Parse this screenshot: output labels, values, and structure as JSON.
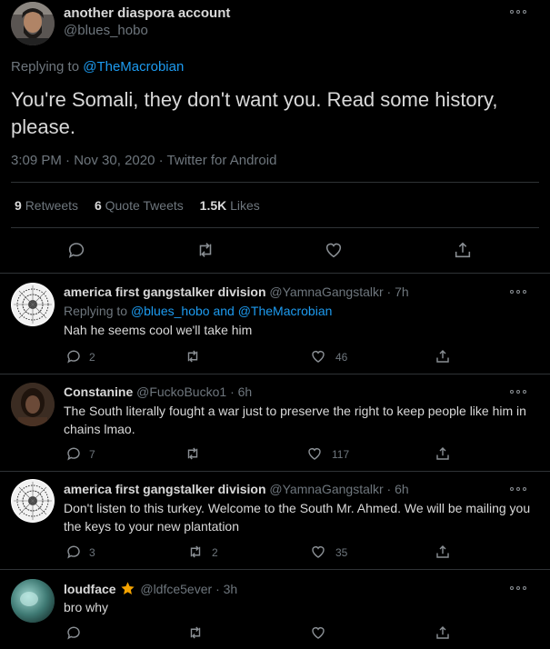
{
  "main_tweet": {
    "display_name": "another diaspora account",
    "handle": "@blues_hobo",
    "replying_prefix": "Replying to",
    "replying_to": "@TheMacrobian",
    "text": "You're Somali, they don't want you. Read some history, please.",
    "time": "3:09 PM",
    "date": "Nov 30, 2020",
    "source": "Twitter for Android",
    "stats": {
      "retweets_count": "9",
      "retweets_label": "Retweets",
      "quotes_count": "6",
      "quotes_label": "Quote Tweets",
      "likes_count": "1.5K",
      "likes_label": "Likes"
    }
  },
  "replies": [
    {
      "display_name": "america first gangstalker division",
      "handle": "@YamnaGangstalkr",
      "age": "7h",
      "replying_prefix": "Replying to",
      "replying_to_1": "@blues_hobo",
      "replying_and": "and",
      "replying_to_2": "@TheMacrobian",
      "text": "Nah he seems cool we'll take him",
      "reply_count": "2",
      "retweet_count": "",
      "like_count": "46"
    },
    {
      "display_name": "Constanine",
      "handle": "@FuckoBucko1",
      "age": "6h",
      "text": "The South literally fought a war just to preserve the right to keep people like him in chains lmao.",
      "reply_count": "7",
      "retweet_count": "",
      "like_count": "117"
    },
    {
      "display_name": "america first gangstalker division",
      "handle": "@YamnaGangstalkr",
      "age": "6h",
      "text": "Don't listen to this turkey. Welcome to the South Mr. Ahmed. We will be mailing you the keys to your new plantation",
      "reply_count": "3",
      "retweet_count": "2",
      "like_count": "35"
    },
    {
      "display_name": "loudface",
      "badge_emoji": "★",
      "handle": "@ldfce5ever",
      "age": "3h",
      "text": "bro why",
      "reply_count": "",
      "retweet_count": "",
      "like_count": ""
    }
  ],
  "separator": "·",
  "colors": {
    "background": "#000000",
    "text": "#d9d9d9",
    "muted": "#6e767d",
    "link": "#1d9bf0",
    "divider": "#2f3336",
    "star": "#f4a300"
  },
  "icons": {
    "more": "more-icon",
    "reply": "reply-icon",
    "retweet": "retweet-icon",
    "like": "heart-icon",
    "share": "share-icon",
    "star": "star-icon"
  }
}
